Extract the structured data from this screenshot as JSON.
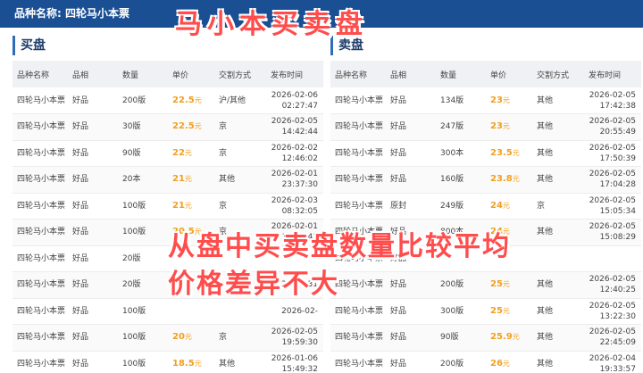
{
  "header": {
    "title": "品种名称: 四轮马小本票"
  },
  "overlay": {
    "title": "马小本买卖盘",
    "note_line1": "从盘中买卖盘数量比较平均",
    "note_line2": "价格差异不大"
  },
  "columns": [
    "品种名称",
    "品相",
    "数量",
    "单价",
    "交割方式",
    "发布时间"
  ],
  "buy": {
    "title": "买盘",
    "rows": [
      {
        "name": "四轮马小本票",
        "quality": "好品",
        "qty": "200版",
        "price": "22.5",
        "unit": "元",
        "delivery": "沪/其他",
        "date": "2026-02-06",
        "time": "02:27:47"
      },
      {
        "name": "四轮马小本票",
        "quality": "好品",
        "qty": "30版",
        "price": "22.5",
        "unit": "元",
        "delivery": "京",
        "date": "2026-02-05",
        "time": "14:42:44"
      },
      {
        "name": "四轮马小本票",
        "quality": "好品",
        "qty": "90版",
        "price": "22",
        "unit": "元",
        "delivery": "京",
        "date": "2026-02-02",
        "time": "12:46:02"
      },
      {
        "name": "四轮马小本票",
        "quality": "好品",
        "qty": "20本",
        "price": "21",
        "unit": "元",
        "delivery": "其他",
        "date": "2026-02-01",
        "time": "23:37:30"
      },
      {
        "name": "四轮马小本票",
        "quality": "好品",
        "qty": "100版",
        "price": "21",
        "unit": "元",
        "delivery": "京",
        "date": "2026-02-03",
        "time": "08:32:05"
      },
      {
        "name": "四轮马小本票",
        "quality": "好品",
        "qty": "100版",
        "price": "20.5",
        "unit": "元",
        "delivery": "京",
        "date": "2026-02-01",
        "time": "14:57:41"
      },
      {
        "name": "四轮马小本票",
        "quality": "好品",
        "qty": "20版",
        "price": "",
        "unit": "",
        "delivery": "",
        "date": "",
        "time": ""
      },
      {
        "name": "四轮马小本票",
        "quality": "好品",
        "qty": "20版",
        "price": "",
        "unit": "",
        "delivery": "",
        "date": "2026-01-31",
        "time": ""
      },
      {
        "name": "四轮马小本票",
        "quality": "好品",
        "qty": "100版",
        "price": "",
        "unit": "",
        "delivery": "",
        "date": "2026-02-",
        "time": ""
      },
      {
        "name": "四轮马小本票",
        "quality": "好品",
        "qty": "100版",
        "price": "20",
        "unit": "元",
        "delivery": "京",
        "date": "2026-02-05",
        "time": "19:59:30"
      },
      {
        "name": "四轮马小本票",
        "quality": "好品",
        "qty": "100版",
        "price": "18.5",
        "unit": "元",
        "delivery": "其他",
        "date": "2026-01-06",
        "time": "15:49:32"
      }
    ]
  },
  "sell": {
    "title": "卖盘",
    "rows": [
      {
        "name": "四轮马小本票",
        "quality": "好品",
        "qty": "134版",
        "price": "23",
        "unit": "元",
        "delivery": "其他",
        "date": "2026-02-05",
        "time": "17:42:38"
      },
      {
        "name": "四轮马小本票",
        "quality": "好品",
        "qty": "247版",
        "price": "23",
        "unit": "元",
        "delivery": "其他",
        "date": "2026-02-05",
        "time": "20:55:49"
      },
      {
        "name": "四轮马小本票",
        "quality": "好品",
        "qty": "300本",
        "price": "23.5",
        "unit": "元",
        "delivery": "其他",
        "date": "2026-02-05",
        "time": "17:50:39"
      },
      {
        "name": "四轮马小本票",
        "quality": "好品",
        "qty": "160版",
        "price": "23.8",
        "unit": "元",
        "delivery": "其他",
        "date": "2026-02-05",
        "time": "17:04:28"
      },
      {
        "name": "四轮马小本票",
        "quality": "原封",
        "qty": "249版",
        "price": "24",
        "unit": "元",
        "delivery": "京",
        "date": "2026-02-05",
        "time": "15:05:34"
      },
      {
        "name": "四轮马小本票",
        "quality": "好品",
        "qty": "800本",
        "price": "24",
        "unit": "元",
        "delivery": "其他",
        "date": "2026-02-05",
        "time": "15:08:29"
      },
      {
        "name": "四轮马小本票",
        "quality": "好品",
        "qty": "",
        "price": "",
        "unit": "",
        "delivery": "",
        "date": "",
        "time": ""
      },
      {
        "name": "四轮马小本票",
        "quality": "好品",
        "qty": "200版",
        "price": "25",
        "unit": "元",
        "delivery": "其他",
        "date": "2026-02-05",
        "time": "12:40:25"
      },
      {
        "name": "四轮马小本票",
        "quality": "好品",
        "qty": "300版",
        "price": "25",
        "unit": "元",
        "delivery": "其他",
        "date": "2026-02-05",
        "time": "13:22:30"
      },
      {
        "name": "四轮马小本票",
        "quality": "好品",
        "qty": "90版",
        "price": "25.9",
        "unit": "元",
        "delivery": "其他",
        "date": "2026-02-05",
        "time": "22:45:09"
      },
      {
        "name": "四轮马小本票",
        "quality": "好品",
        "qty": "200版",
        "price": "26",
        "unit": "元",
        "delivery": "其他",
        "date": "2026-02-04",
        "time": "19:33:57"
      }
    ]
  }
}
